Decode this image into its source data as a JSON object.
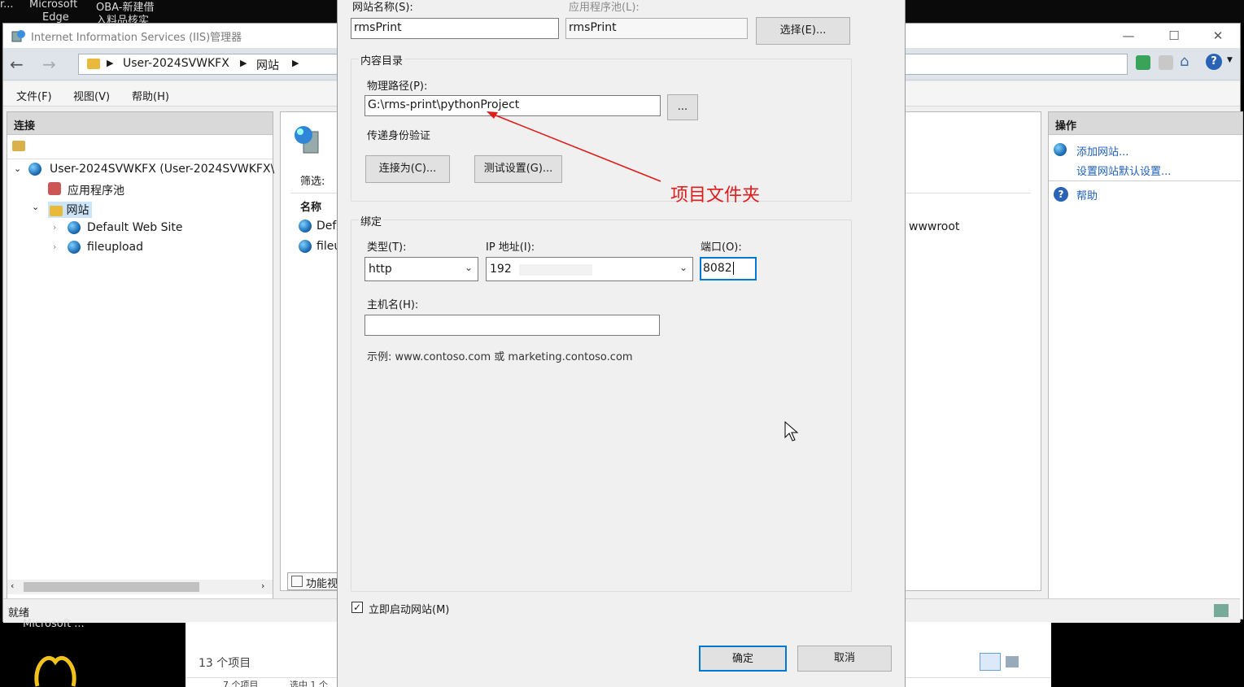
{
  "desktop": {
    "top_labels": [
      "r...",
      "Microsoft",
      "OBA-新建借",
      "Edge",
      "入料品核实"
    ],
    "bottom_label": "Microsoft ...",
    "bottom_count": "13 个项目",
    "bottom_count2": "7 个项目",
    "bottom_selected": "选中 1 个"
  },
  "iis": {
    "title": "Internet Information Services (IIS)管理器",
    "breadcrumb": [
      "User-2024SVWKFX",
      "网站"
    ],
    "menu": [
      "文件(F)",
      "视图(V)",
      "帮助(H)"
    ],
    "connections_header": "连接",
    "tree": {
      "server": "User-2024SVWKFX (User-2024SVWKFX\\",
      "app_pools": "应用程序池",
      "sites": "网站",
      "site1": "Default Web Site",
      "site2": "fileupload"
    },
    "mid": {
      "filter_label": "筛选:",
      "name_header": "名称",
      "row1": "Defa",
      "row2": "fileu",
      "path_fragment": "wwwroot",
      "bottom_tab": "功能视"
    },
    "actions": {
      "header": "操作",
      "add_site": "添加网站...",
      "site_defaults": "设置网站默认设置...",
      "help": "帮助"
    },
    "status": "就绪"
  },
  "dialog": {
    "site_name_label": "网站名称(S):",
    "site_name_value": "rmsPrint",
    "app_pool_label": "应用程序池(L):",
    "app_pool_value": "rmsPrint",
    "select_button": "选择(E)...",
    "content_dir_title": "内容目录",
    "physical_path_label": "物理路径(P):",
    "physical_path_value": "G:\\rms-print\\pythonProject",
    "browse_button": "...",
    "pass_auth_label": "传递身份验证",
    "connect_as_button": "连接为(C)...",
    "test_settings_button": "测试设置(G)...",
    "binding_title": "绑定",
    "type_label": "类型(T):",
    "type_value": "http",
    "ip_label": "IP 地址(I):",
    "ip_value": "192",
    "port_label": "端口(O):",
    "port_value": "8082",
    "hostname_label": "主机名(H):",
    "hostname_value": "",
    "example_text": "示例: www.contoso.com 或 marketing.contoso.com",
    "start_now_label": "立即启动网站(M)",
    "start_now_checked": true,
    "ok_button": "确定",
    "cancel_button": "取消"
  },
  "annotation": {
    "text": "项目文件夹",
    "color": "#e21b1b"
  }
}
